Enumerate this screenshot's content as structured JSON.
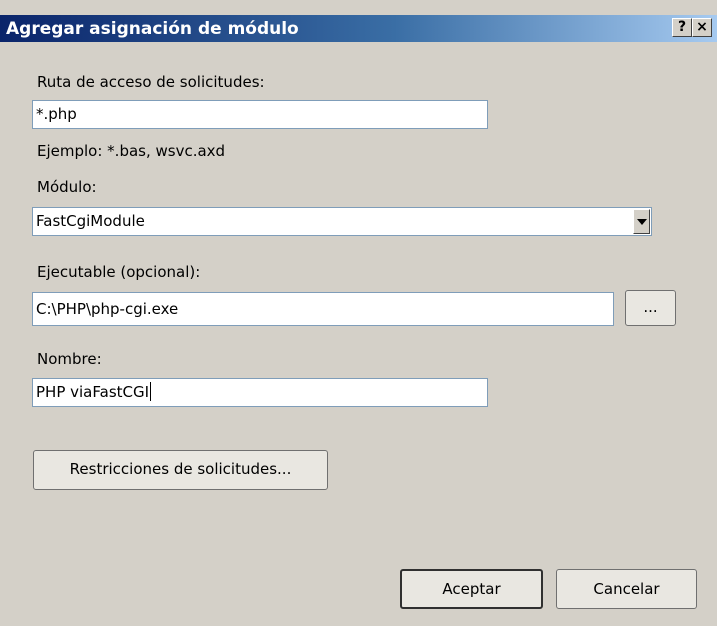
{
  "window": {
    "title": "Agregar asignación de módulo",
    "help_label": "?",
    "close_label": "×"
  },
  "request_path": {
    "label": "Ruta de acceso de solicitudes:",
    "value": "*.php",
    "example": "Ejemplo: *.bas, wsvc.axd"
  },
  "module": {
    "label": "Módulo:",
    "selected": "FastCgiModule"
  },
  "executable": {
    "label": "Ejecutable (opcional):",
    "value": "C:\\PHP\\php-cgi.exe",
    "browse_label": "..."
  },
  "name": {
    "label": "Nombre:",
    "value": "PHP viaFastCGI"
  },
  "buttons": {
    "restrictions": "Restricciones de solicitudes...",
    "ok": "Aceptar",
    "cancel": "Cancelar"
  }
}
